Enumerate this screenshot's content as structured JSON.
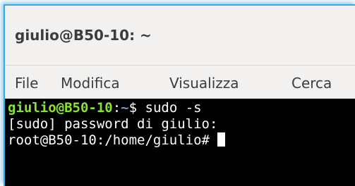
{
  "window": {
    "title": "giulio@B50-10: ~"
  },
  "menu": {
    "items": [
      "File",
      "Modifica",
      "Visualizza",
      "Cerca"
    ]
  },
  "terminal": {
    "line1": {
      "user_host": "giulio@B50-10",
      "colon": ":",
      "path": "~",
      "dollar": "$ ",
      "command": "sudo -s"
    },
    "line2": "[sudo] password di giulio:",
    "line3": "root@B50-10:/home/giulio# "
  },
  "colors": {
    "window_bg": "#f2f1f0",
    "accent_border": "#3fa7e0",
    "terminal_bg": "#000000",
    "terminal_fg": "#ffffff",
    "prompt_user": "#8ae234",
    "prompt_path": "#729fcf"
  }
}
